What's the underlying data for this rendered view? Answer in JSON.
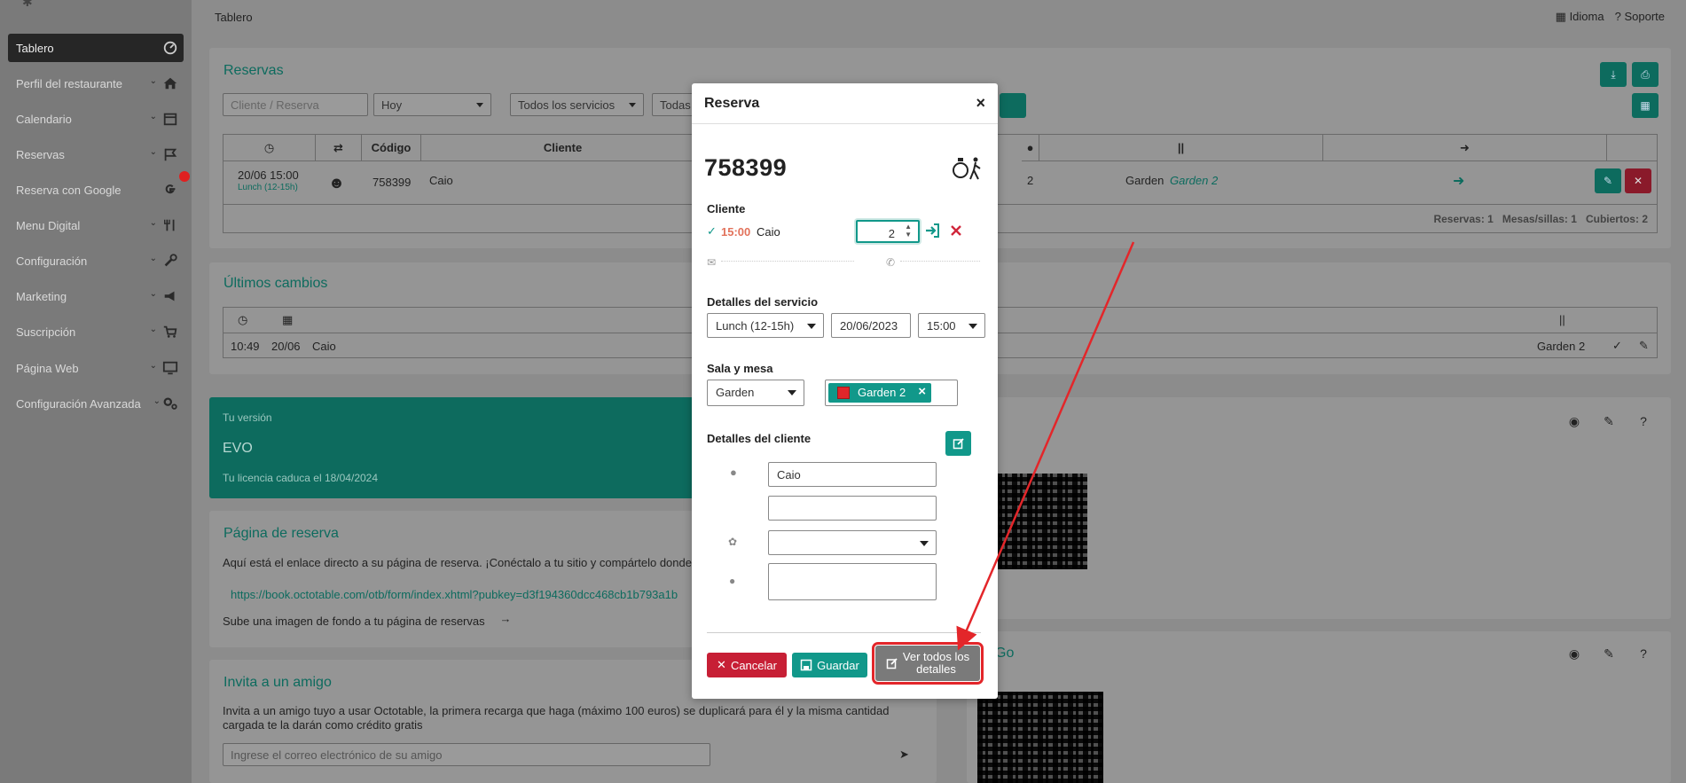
{
  "sidebar": {
    "items": [
      {
        "label": "Tablero",
        "icon": "dashboard-icon"
      },
      {
        "label": "Perfil del restaurante",
        "icon": "home-icon"
      },
      {
        "label": "Calendario",
        "icon": "calendar-icon"
      },
      {
        "label": "Reservas",
        "icon": "flag-icon"
      },
      {
        "label": "Reserva con Google",
        "icon": "google-icon"
      },
      {
        "label": "Menu Digital",
        "icon": "utensils-icon"
      },
      {
        "label": "Configuración",
        "icon": "wrench-icon"
      },
      {
        "label": "Marketing",
        "icon": "megaphone-icon"
      },
      {
        "label": "Suscripción",
        "icon": "cart-icon"
      },
      {
        "label": "Página Web",
        "icon": "monitor-icon"
      },
      {
        "label": "Configuración Avanzada",
        "icon": "cogs-icon"
      }
    ]
  },
  "topbar": {
    "breadcrumb": "Tablero",
    "language": "Idioma",
    "support": "Soporte"
  },
  "reservas": {
    "title": "Reservas",
    "search_placeholder": "Cliente  / Reserva",
    "date_filter": "Hoy",
    "service_filter": "Todos los servicios",
    "other_filter": "Todas",
    "headers": {
      "code": "Código",
      "client": "Cliente"
    },
    "row": {
      "datetime": "20/06 15:00",
      "service": "Lunch (12-15h)",
      "code": "758399",
      "client": "Caio",
      "seats": "2",
      "room": "Garden",
      "table": "Garden 2"
    },
    "summary": {
      "reservations_label": "Reservas:",
      "reservations": "1",
      "tables_label": "Mesas/sillas:",
      "tables": "1",
      "covers_label": "Cubiertos:",
      "covers": "2"
    }
  },
  "ultimos": {
    "title": "Últimos cambios",
    "row": {
      "time": "10:49",
      "date": "20/06",
      "client": "Caio",
      "table": "Garden 2"
    }
  },
  "version": {
    "label": "Tu versión",
    "name": "EVO",
    "license": "Tu licencia caduca el 18/04/2024"
  },
  "booking_page": {
    "title": "Página de reserva",
    "text": "Aquí está el enlace directo a su página de reserva. ¡Conéctalo a tu sitio y compártelo donde",
    "link": "https://book.octotable.com/otb/form/index.xhtml?pubkey=d3f194360dcc468cb1b793a1b",
    "upload": "Sube una imagen de fondo a tu página de reservas"
  },
  "invite": {
    "title": "Invita a un amigo",
    "text": "Invita a un amigo tuyo a usar Octotable, la primera recarga que haga (máximo 100 euros) se duplicará para él y la misma cantidad cargada te la darán como crédito gratis",
    "placeholder": "Ingrese el correo electrónico de su amigo"
  },
  "go_card": {
    "title": "Go"
  },
  "modal": {
    "title": "Reserva",
    "close": "×",
    "code": "758399",
    "client_section": "Cliente",
    "time": "15:00",
    "client_name": "Caio",
    "pax": "2",
    "service_section": "Detalles del servicio",
    "service": "Lunch (12-15h)",
    "date": "20/06/2023",
    "hour": "15:00",
    "room_section": "Sala y mesa",
    "room": "Garden",
    "table": "Garden 2",
    "table_remove": "×",
    "client_details_section": "Detalles del cliente",
    "name_value": "Caio",
    "cancel": "Cancelar",
    "save": "Guardar",
    "details_line1": "Ver todos los",
    "details_line2": "detalles"
  },
  "colors": {
    "primary": "#11988a",
    "danger": "#c71f35",
    "annotation": "#e3262a"
  }
}
